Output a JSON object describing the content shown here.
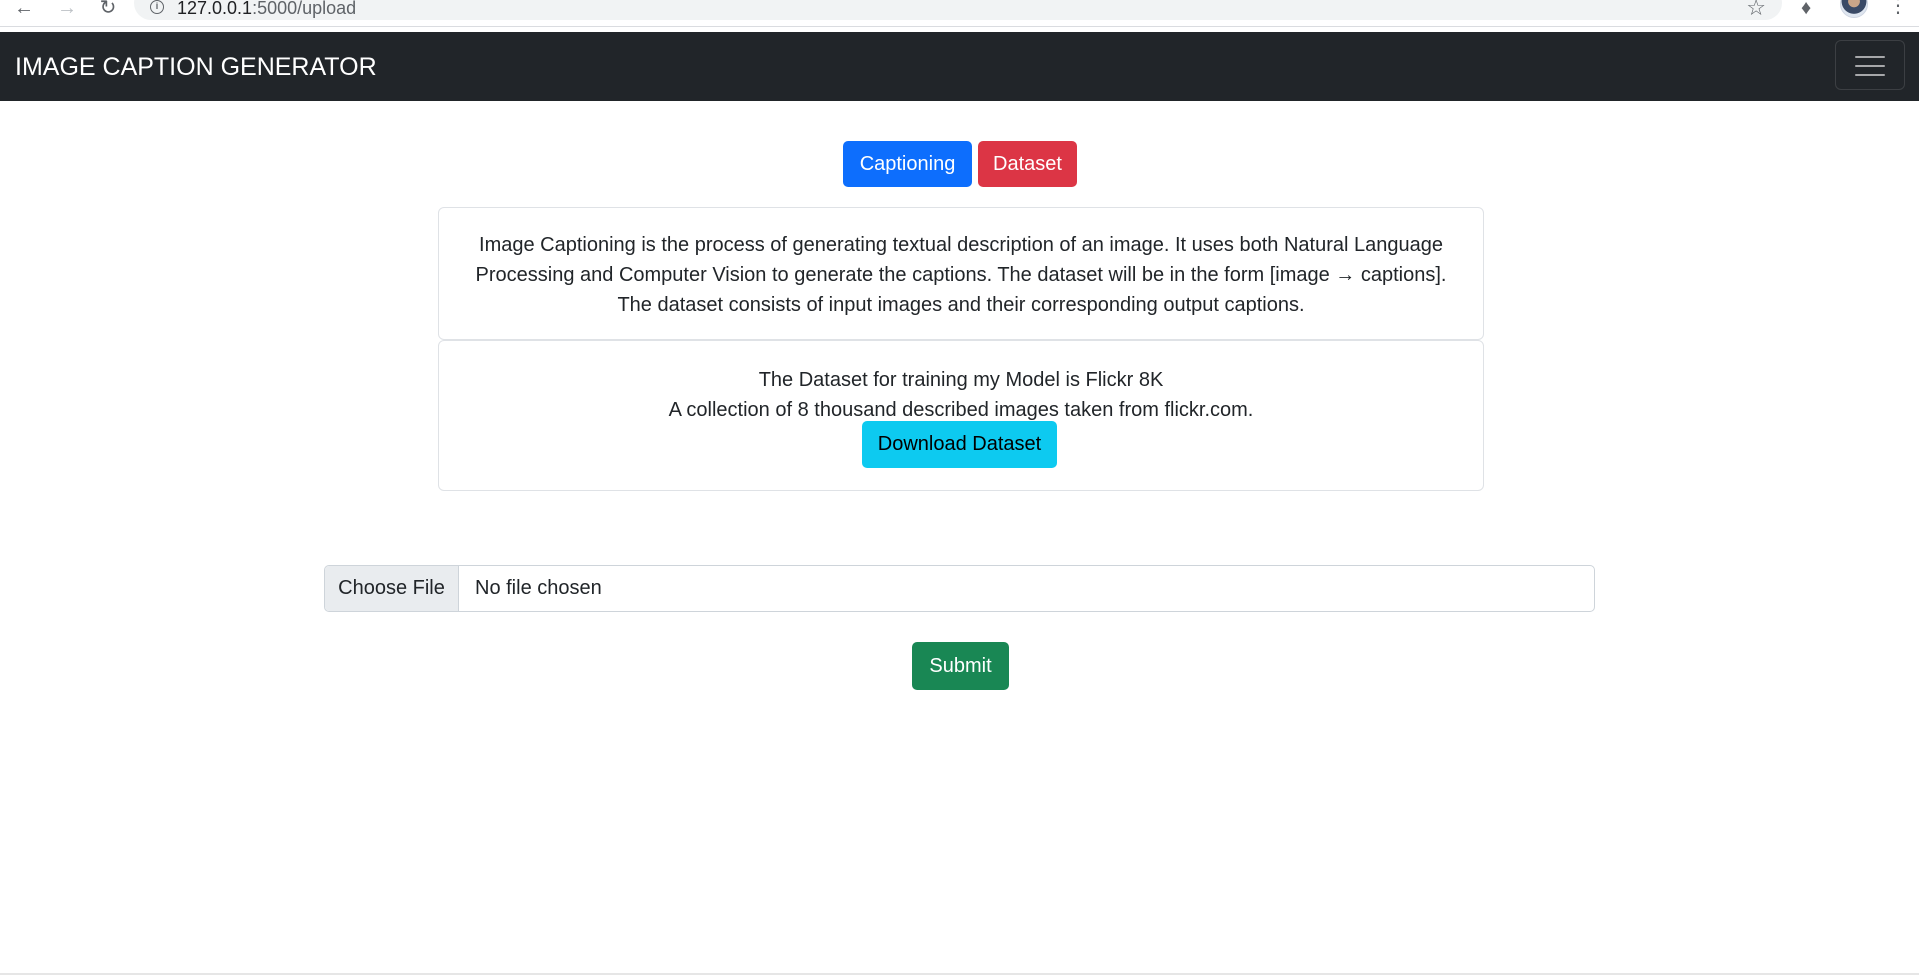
{
  "browser": {
    "url_host": "127.0.0.1",
    "url_path": ":5000/upload"
  },
  "navbar": {
    "brand": "IMAGE CAPTION GENERATOR"
  },
  "tabs": {
    "captioning_label": "Captioning",
    "dataset_label": "Dataset"
  },
  "about_card": {
    "text": "Image Captioning is the process of generating textual description of an image. It uses both Natural Language Processing and Computer Vision to generate the captions. The dataset will be in the form [image → captions]. The dataset consists of input images and their corresponding output captions."
  },
  "dataset_card": {
    "line1": "The Dataset for training my Model is Flickr 8K",
    "line2": "A collection of 8 thousand described images taken from flickr.com.",
    "download_label": "Download Dataset"
  },
  "upload": {
    "choose_label": "Choose File",
    "status": "No file chosen"
  },
  "submit_label": "Submit",
  "colors": {
    "navbar": "#212529",
    "primary": "#0d6efd",
    "danger": "#dc3545",
    "info": "#0dcaf0",
    "success": "#198754"
  }
}
